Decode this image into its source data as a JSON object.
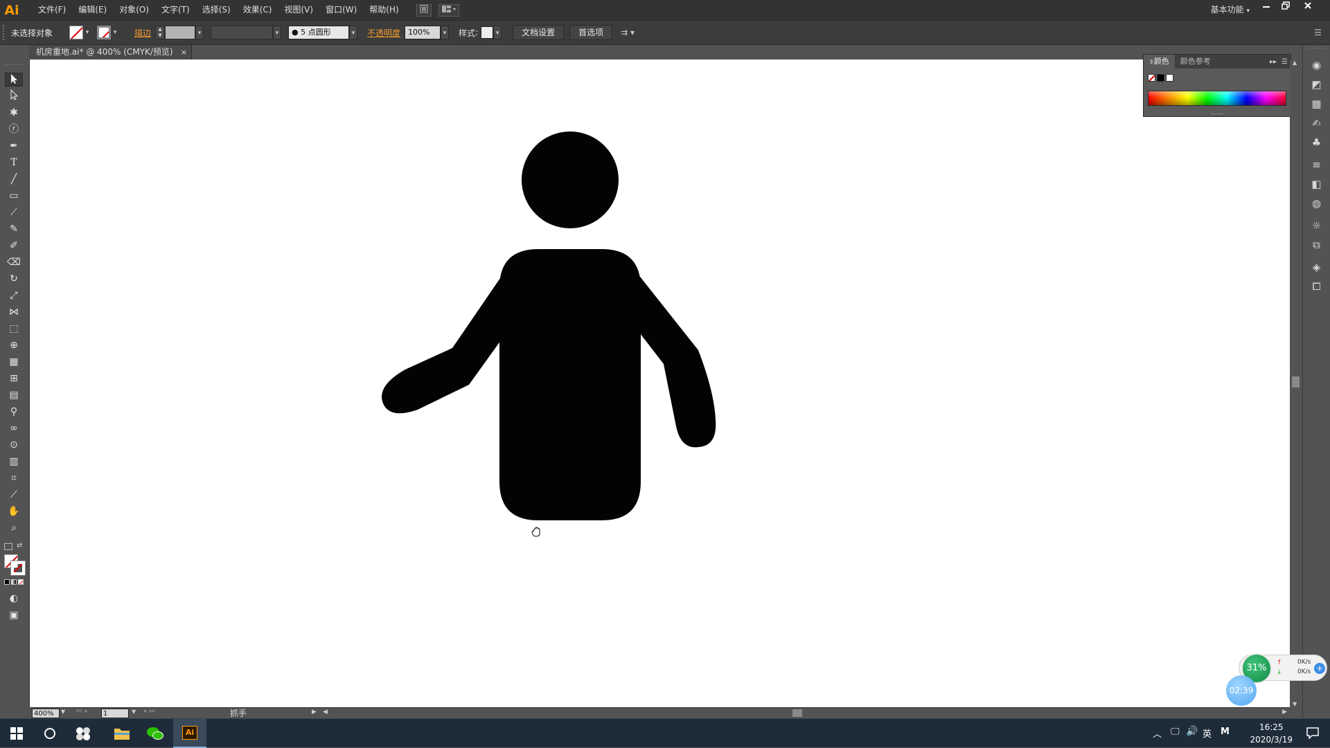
{
  "app": {
    "logo": "Ai",
    "workspace": "基本功能"
  },
  "menubar": [
    "文件(F)",
    "编辑(E)",
    "对象(O)",
    "文字(T)",
    "选择(S)",
    "效果(C)",
    "视图(V)",
    "窗口(W)",
    "帮助(H)"
  ],
  "control_bar": {
    "selection_status": "未选择对象",
    "stroke_label": "描边",
    "brush_value": "5 点圆形",
    "opacity_label": "不透明度",
    "opacity_value": "100%",
    "style_label": "样式",
    "doc_setup_button": "文档设置",
    "preferences_button": "首选项"
  },
  "document_tab": {
    "title": "机房重地.ai* @ 400% (CMYK/预览)",
    "close_symbol": "×"
  },
  "color_panel": {
    "tabs": [
      "颜色",
      "颜色参考"
    ]
  },
  "status_bar": {
    "zoom": "400%",
    "artboard": "1",
    "tool_name": "抓手"
  },
  "canvas": {
    "figure_color": "#040202"
  },
  "widget": {
    "cpu_percent": "31%",
    "upload": "0K/s",
    "download": "0K/s",
    "timer": "02:39"
  },
  "taskbar": {
    "time": "16:25",
    "date": "2020/3/19",
    "ime": "英",
    "ime2": "M"
  }
}
